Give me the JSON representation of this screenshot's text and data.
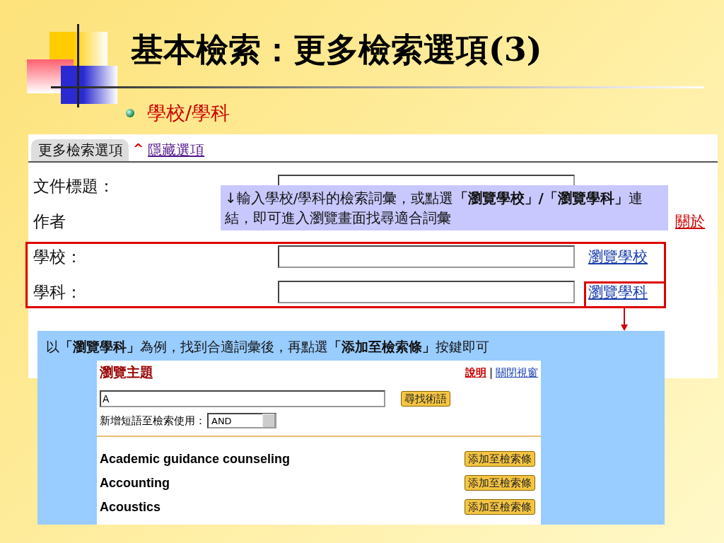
{
  "title": "基本檢索：更多檢索選項(3)",
  "bullet": "學校/學科",
  "form": {
    "tab": "更多檢索選項",
    "toggle_icon": "^",
    "hide_link": "隱藏選項",
    "rows": [
      {
        "label": "文件標題：",
        "kind": "text"
      },
      {
        "label": "作者",
        "kind": "label_only",
        "link": {
          "text": "關於",
          "kind": "about"
        }
      },
      {
        "label": "學校：",
        "kind": "text",
        "link": {
          "text": "瀏覽學校",
          "kind": "browse"
        }
      },
      {
        "label": "學科：",
        "kind": "text",
        "link": {
          "text": "瀏覽學科",
          "kind": "browse"
        }
      }
    ]
  },
  "callout_top": "↓輸入學校/學科的檢索詞彙，或點選**「瀏覽學校」/「瀏覽學科」**連結，即可進入瀏覽畫面找尋適合詞彙",
  "callout_bottom": "以**「瀏覽學科」**為例，找到合適詞彙後，再點選**「添加至檢索條」**按鍵即可",
  "browse": {
    "title": "瀏覽主題",
    "help_link": "說明",
    "separator": "|",
    "close_link": "關閉視窗",
    "query": "A",
    "find_button": "尋找術語",
    "operator_label": "新增短語至檢索使用：",
    "operator": "AND",
    "terms": [
      {
        "term": "Academic guidance counseling",
        "button": "添加至檢索條"
      },
      {
        "term": "Accounting",
        "button": "添加至檢索條"
      },
      {
        "term": "Acoustics",
        "button": "添加至檢索條"
      }
    ]
  }
}
